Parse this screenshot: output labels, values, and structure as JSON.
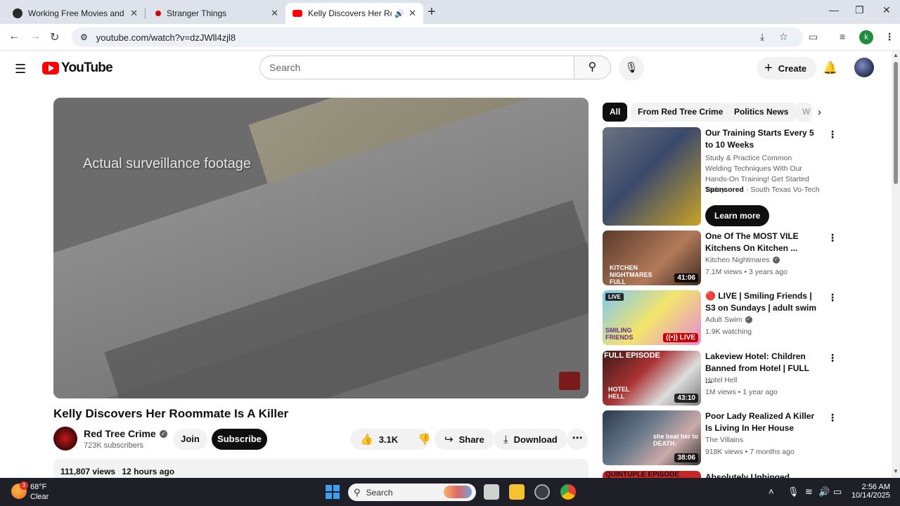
{
  "browser": {
    "tabs": [
      {
        "title": "Working Free Movies and TV Sh",
        "favicon_color": "#1e1e1e"
      },
      {
        "title": "Stranger Things",
        "favicon_color": "#d40000"
      },
      {
        "title": "Kelly Discovers Her Roomm",
        "favicon_color": "#ff0000",
        "audio": "🔊"
      }
    ],
    "new_tab": "+",
    "url": "youtube.com/watch?v=dzJWll4zjl8",
    "profile_letter": "k"
  },
  "yt": {
    "logo_text": "YouTube",
    "search_placeholder": "Search",
    "create_label": "Create"
  },
  "video": {
    "overlay_caption": "Actual surveillance footage",
    "title": "Kelly Discovers Her Roommate Is A Killer",
    "channel": "Red Tree Crime",
    "subscribers": "723K subscribers",
    "join_label": "Join",
    "subscribe_label": "Subscribe",
    "likes": "3.1K",
    "share_label": "Share",
    "download_label": "Download",
    "views": "111,807 views",
    "posted": "12 hours ago"
  },
  "chips": [
    "All",
    "From Red Tree Crime",
    "Politics News",
    "W"
  ],
  "recommended": [
    {
      "title": "Our Training Starts Every 5 to 10 Weeks",
      "desc": "Study & Practice Common Welding Techniques With Our Hands-On Training! Get Started Today.",
      "sponsored": "Sponsored",
      "advertiser": "South Texas Vo-Tech",
      "cta": "Learn more"
    },
    {
      "title": "One Of The MOST VILE Kitchens On Kitchen ...",
      "channel": "Kitchen Nightmares",
      "meta": "7.1M views • 3 years ago",
      "duration": "41:06",
      "thumb_text": "KITCHEN NIGHTMARES FULL EPISODE"
    },
    {
      "title": "🔴 LIVE | Smiling Friends | S3 on Sundays | adult swim",
      "channel": "Adult Swim",
      "meta": "1.9K watching",
      "live_badge": "LIVE",
      "live_tag": "LIVE",
      "thumb_text": "SMILING FRIENDS"
    },
    {
      "title": "Lakeview Hotel: Children Banned from Hotel | FULL ...",
      "channel": "Hotel Hell",
      "meta": "1M views • 1 year ago",
      "duration": "43:10",
      "thumb_top": "FULL EPISODE",
      "thumb_text": "HOTEL HELL"
    },
    {
      "title": "Poor Lady Realized A Killer Is Living In Her House",
      "channel": "The Villains",
      "meta": "918K views • 7 months ago",
      "duration": "38:06",
      "thumb_text": "she beat her to DEATH."
    },
    {
      "title": "Absolutely Unhinged Episodes |",
      "thumb_text": "QUINTUPLE EPISODE"
    }
  ],
  "taskbar": {
    "temp": "68°F",
    "condition": "Clear",
    "weather_badge": "3",
    "search_label": "Search",
    "time": "2:56 AM",
    "date": "10/14/2025"
  }
}
